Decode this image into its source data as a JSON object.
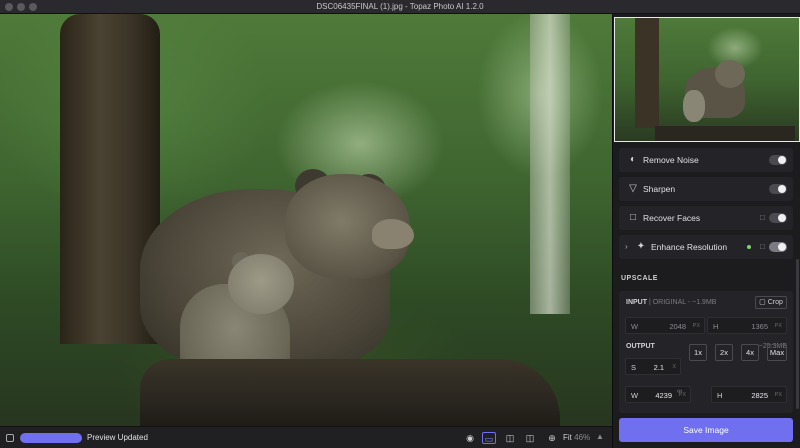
{
  "window": {
    "title": "DSC06435FINAL (1).jpg - Topaz Photo AI 1.2.0"
  },
  "status": {
    "text": "Preview Updated",
    "progress": 1.0
  },
  "view": {
    "zoom_label": "Fit",
    "zoom_value": "46%"
  },
  "filters": [
    {
      "label": "Remove Noise",
      "icon": "noise-icon",
      "enabled": false,
      "locked": false
    },
    {
      "label": "Sharpen",
      "icon": "sharpen-icon",
      "enabled": false,
      "locked": false
    },
    {
      "label": "Recover Faces",
      "icon": "face-icon",
      "enabled": false,
      "locked": true
    },
    {
      "label": "Enhance Resolution",
      "icon": "sparkle-icon",
      "enabled": true,
      "locked": true
    }
  ],
  "upscale": {
    "section_label": "UPSCALE",
    "input_label": "INPUT",
    "input_meta": "| ORIGINAL - ~1.9MB",
    "crop_label": "Crop",
    "input_w": "2048",
    "input_h": "1365",
    "output_label": "OUTPUT",
    "output_meta": "~25.3MB",
    "scale": "2.1",
    "scale_unit": "X",
    "presets": [
      "1x",
      "2x",
      "4x",
      "Max"
    ],
    "output_w": "4239",
    "output_h": "2825",
    "unit": "PX",
    "w_key": "W",
    "h_key": "H",
    "s_key": "S"
  },
  "actions": {
    "save_label": "Save Image"
  },
  "colors": {
    "accent": "#6f6ff0",
    "panel_bg": "#1c1c1f",
    "active_dot": "#7cd46a"
  }
}
